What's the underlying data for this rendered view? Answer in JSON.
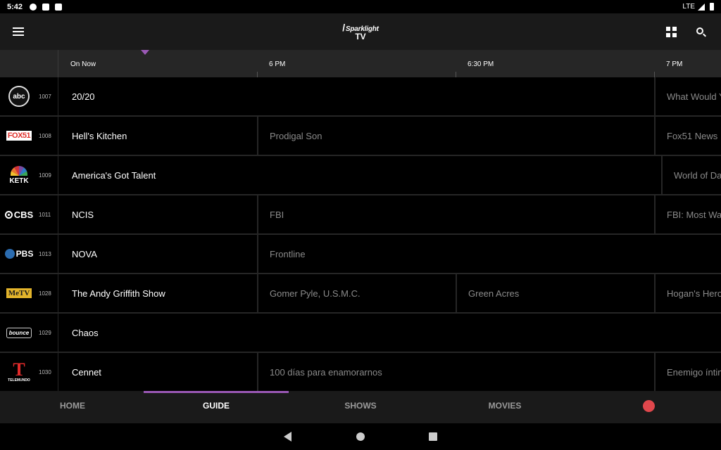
{
  "status_bar": {
    "time": "5:42",
    "network": "LTE",
    "icons": [
      "settings-icon",
      "app-notification-icon",
      "sd-card-icon",
      "signal-icon",
      "battery-icon"
    ]
  },
  "app_bar": {
    "logo_brand": "Sparklight",
    "logo_sub": "TV",
    "icons": [
      "menu-icon",
      "grid-icon",
      "search-icon"
    ]
  },
  "time_header": {
    "on_now": "On Now",
    "slots": [
      "6 PM",
      "6:30 PM",
      "7 PM"
    ]
  },
  "guide": {
    "rows": [
      {
        "number": "1007",
        "network": "abc",
        "programs": [
          {
            "title": "20/20"
          },
          {
            "title": "What Would You Do?"
          }
        ]
      },
      {
        "number": "1008",
        "network": "FOX51",
        "programs": [
          {
            "title": "Hell's Kitchen"
          },
          {
            "title": "Prodigal Son"
          },
          {
            "title": "Fox51 News"
          }
        ]
      },
      {
        "number": "1009",
        "network": "KETK",
        "programs": [
          {
            "title": "America's Got Talent"
          },
          {
            "title": "World of Dance"
          }
        ]
      },
      {
        "number": "1011",
        "network": "CBS",
        "programs": [
          {
            "title": "NCIS"
          },
          {
            "title": "FBI"
          },
          {
            "title": "FBI: Most Wanted"
          }
        ]
      },
      {
        "number": "1013",
        "network": "PBS",
        "programs": [
          {
            "title": "NOVA"
          },
          {
            "title": "Frontline"
          }
        ]
      },
      {
        "number": "1028",
        "network": "MeTV",
        "programs": [
          {
            "title": "The Andy Griffith Show"
          },
          {
            "title": "Gomer Pyle, U.S.M.C."
          },
          {
            "title": "Green Acres"
          },
          {
            "title": "Hogan's Heroes"
          }
        ]
      },
      {
        "number": "1029",
        "network": "bounce",
        "programs": [
          {
            "title": "Chaos"
          }
        ]
      },
      {
        "number": "1030",
        "network": "TELEMUNDO",
        "programs": [
          {
            "title": "Cennet"
          },
          {
            "title": "100 días para enamorarnos"
          },
          {
            "title": "Enemigo íntimo"
          }
        ]
      }
    ]
  },
  "bottom_nav": {
    "items": [
      {
        "label": "HOME"
      },
      {
        "label": "GUIDE"
      },
      {
        "label": "SHOWS"
      },
      {
        "label": "MOVIES"
      }
    ],
    "active": "GUIDE",
    "record_color": "#e0474c"
  },
  "colors": {
    "accent": "#9b59b6",
    "background": "#000000",
    "header": "#1a1a1a",
    "dim_text": "#8a8a8a"
  }
}
